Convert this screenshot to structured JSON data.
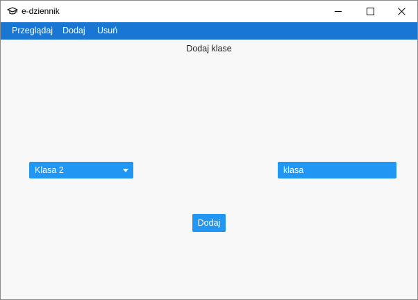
{
  "window": {
    "title": "e-dziennik",
    "icon": "graduation-cap-icon"
  },
  "menu": {
    "items": [
      {
        "label": "Przeglądaj"
      },
      {
        "label": "Dodaj"
      },
      {
        "label": "Usuń"
      }
    ]
  },
  "page": {
    "heading": "Dodaj klase"
  },
  "form": {
    "class_select_value": "Klasa 2",
    "class_input_value": "klasa",
    "add_button_label": "Dodaj"
  },
  "colors": {
    "menubar": "#1976d2",
    "control": "#2196f3",
    "background": "#f8f8f8"
  }
}
